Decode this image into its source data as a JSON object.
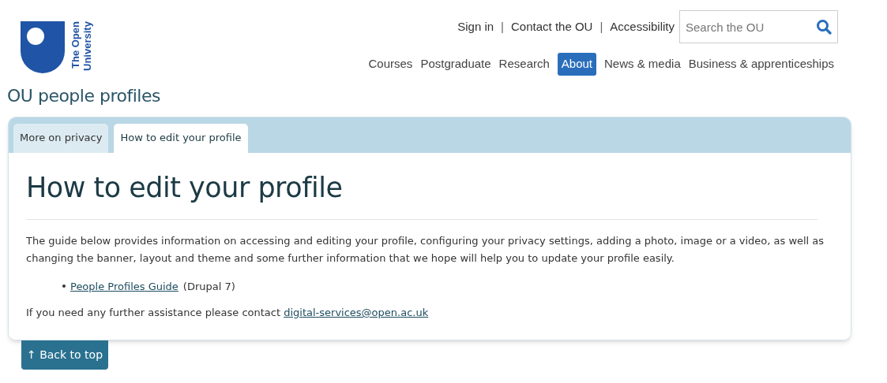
{
  "logo": {
    "lines": [
      "The Open",
      "University"
    ]
  },
  "utility_nav": [
    {
      "kind": "link",
      "text": "Sign in"
    },
    {
      "kind": "separator",
      "text": "|"
    },
    {
      "kind": "link",
      "text": "Contact the OU"
    },
    {
      "kind": "separator",
      "text": "|"
    },
    {
      "kind": "link",
      "text": "Accessibility"
    }
  ],
  "search": {
    "placeholder": "Search the OU"
  },
  "main_nav": [
    {
      "label": "Courses",
      "selected": false
    },
    {
      "label": "Postgraduate",
      "selected": false
    },
    {
      "label": "Research",
      "selected": false
    },
    {
      "label": "About",
      "selected": true
    },
    {
      "label": "News & media",
      "selected": false
    },
    {
      "label": "Business & apprenticeships",
      "selected": false
    }
  ],
  "site_title": "OU people profiles",
  "tabs": [
    {
      "label": "More on privacy",
      "selected": false
    },
    {
      "label": "How to edit your profile",
      "selected": true
    }
  ],
  "content": {
    "heading": "How to edit your profile",
    "intro": "The guide below provides information on accessing and editing your profile, configuring your privacy settings, adding a photo, image or a video, as well as changing the banner, layout and theme and some further information that we hope will help you to update your profile easily.",
    "list": [
      {
        "link": "People Profiles Guide",
        "note": "(Drupal 7)"
      }
    ],
    "contact_text": "If you need any further assistance please contact",
    "contact_link": "digital-services@open.ac.uk"
  },
  "back_to_top": "↑ Back to top"
}
